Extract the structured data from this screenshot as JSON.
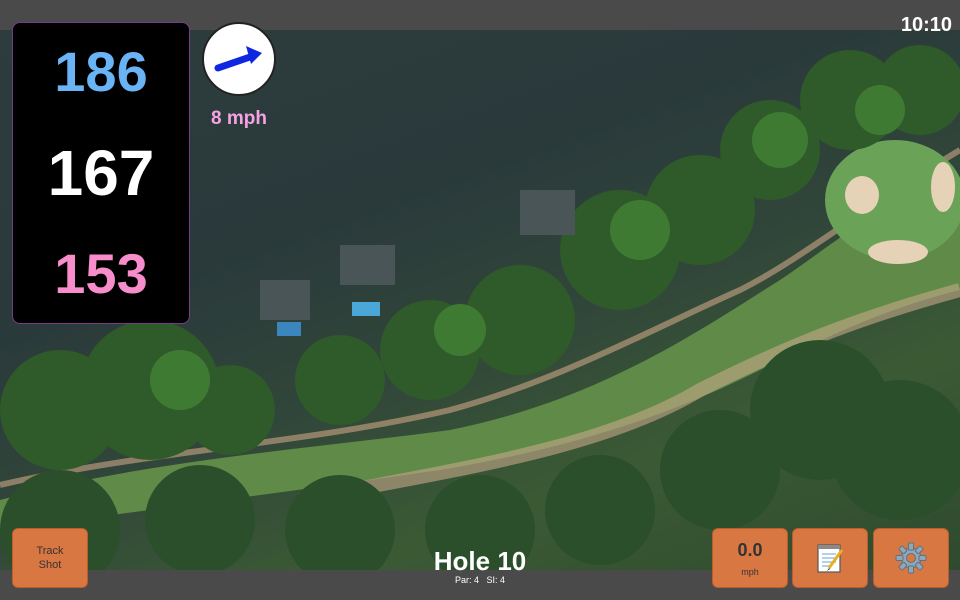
{
  "status": {
    "time": "10:10"
  },
  "distances": {
    "back": "186",
    "center": "167",
    "front": "153",
    "colors": {
      "back": "#6ab4f5",
      "center": "#ffffff",
      "front": "#f78ecb"
    }
  },
  "wind": {
    "speed_label": "8 mph",
    "icon": "wind-arrow-icon",
    "arrow_color": "#0f27e0"
  },
  "buttons": {
    "track_shot": {
      "line1": "Track",
      "line2": "Shot"
    },
    "speed": {
      "value": "0.0",
      "unit": "mph"
    },
    "notes": {
      "icon": "notepad-icon"
    },
    "settings": {
      "icon": "gear-icon"
    }
  },
  "hole": {
    "title": "Hole 10",
    "par": "Par: 4",
    "si": "SI: 4"
  },
  "colors": {
    "accent": "#d97742",
    "panel": "#000000"
  }
}
